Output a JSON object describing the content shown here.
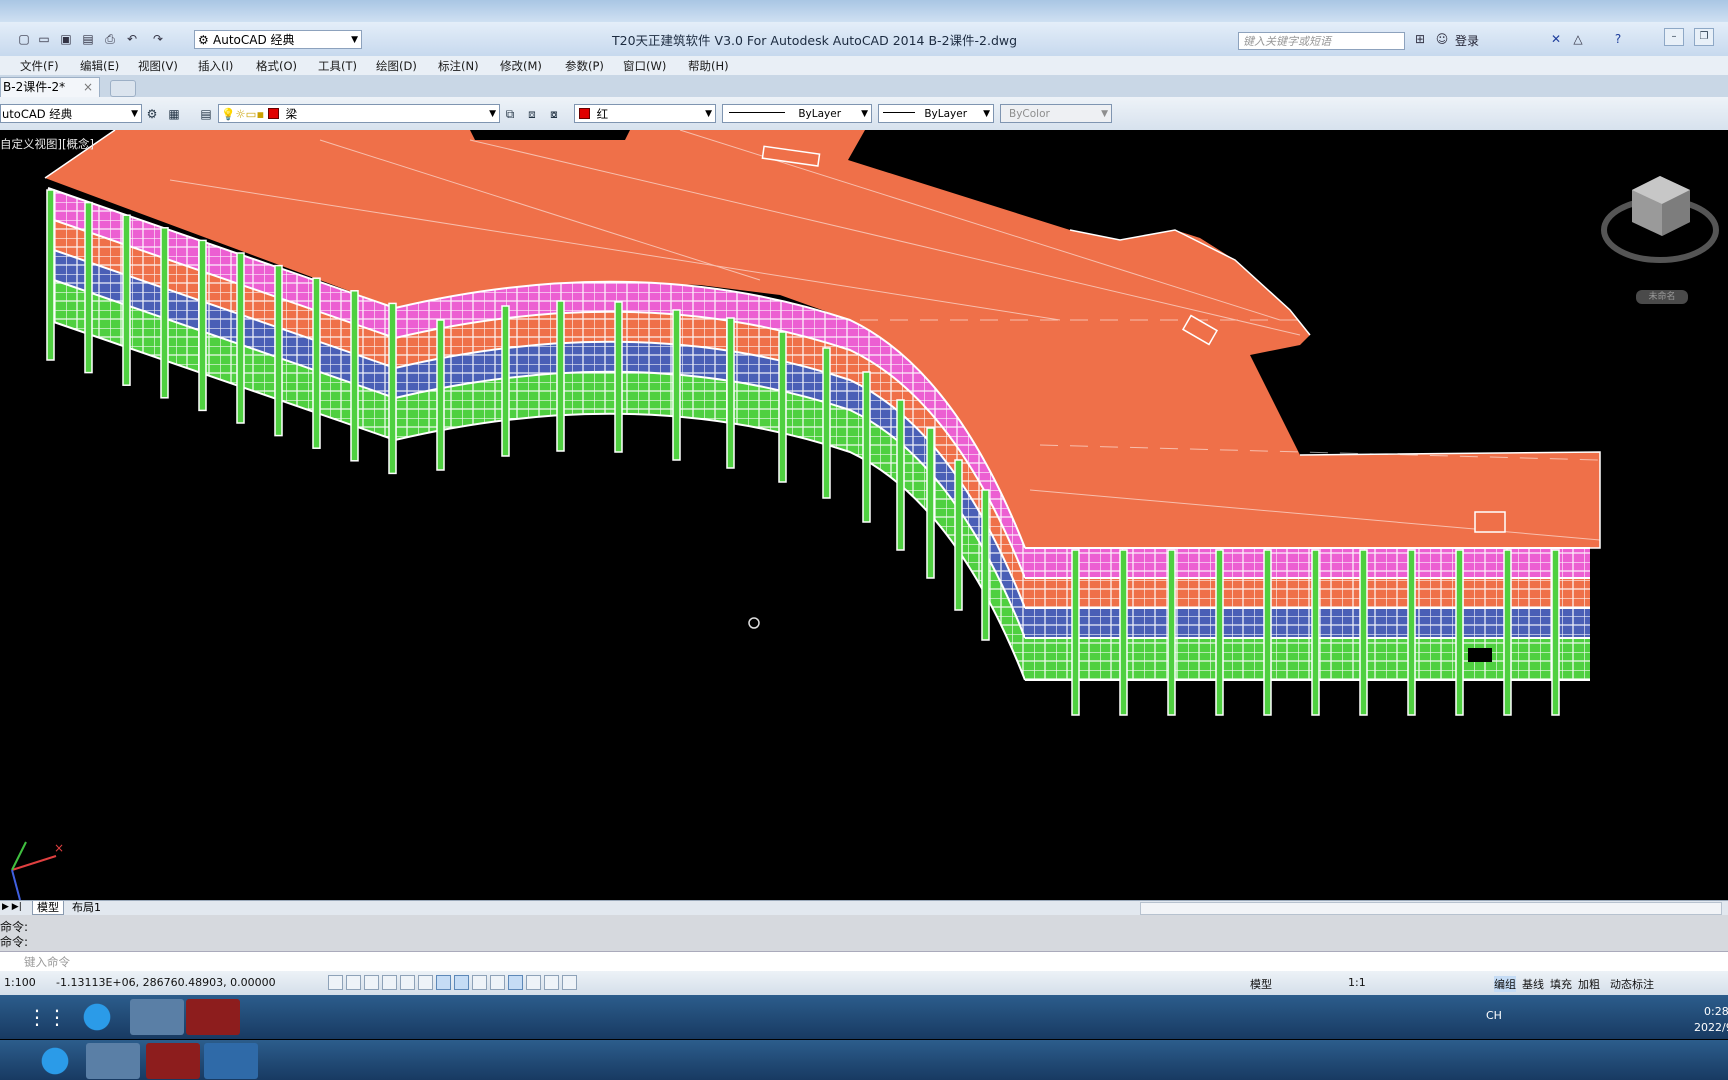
{
  "app": {
    "workspace": "AutoCAD 经典",
    "title": "T20天正建筑软件 V3.0 For Autodesk AutoCAD 2014      B-2课件-2.dwg",
    "search_placeholder": "键入关键字或短语",
    "login": "登录"
  },
  "menu": [
    "文件(F)",
    "编辑(E)",
    "视图(V)",
    "插入(I)",
    "格式(O)",
    "工具(T)",
    "绘图(D)",
    "标注(N)",
    "修改(M)",
    "参数(P)",
    "窗口(W)",
    "帮助(H)"
  ],
  "doc_tab": {
    "label": "B-2课件-2*",
    "close": "×"
  },
  "toolbar": {
    "workspace": "utoCAD 经典",
    "layer": "梁",
    "color": "红",
    "linetype": "ByLayer",
    "lineweight": "ByLayer",
    "plotstyle": "ByColor"
  },
  "viewport": {
    "label": "自定义视图][概念]",
    "viewcube_label": "未命名",
    "colors": {
      "roof": "#ef7049",
      "pink": "#ec5fd2",
      "blue": "#4a5fb6",
      "green": "#4fd040",
      "frame": "#ffffff"
    }
  },
  "layout_tabs": [
    "模型",
    "布局1"
  ],
  "command": {
    "history": [
      "命令:",
      "命令:"
    ],
    "placeholder": "键入命令"
  },
  "status": {
    "scale": "1:100",
    "coords": "-1.13113E+06,  286760.48903,  0.00000",
    "right_items": [
      "模型",
      "1:1",
      "编组",
      "基线",
      "填充",
      "加粗",
      "动态标注"
    ]
  },
  "tray": {
    "lang": "CH",
    "time": "0:28",
    "date": "2022/9"
  }
}
